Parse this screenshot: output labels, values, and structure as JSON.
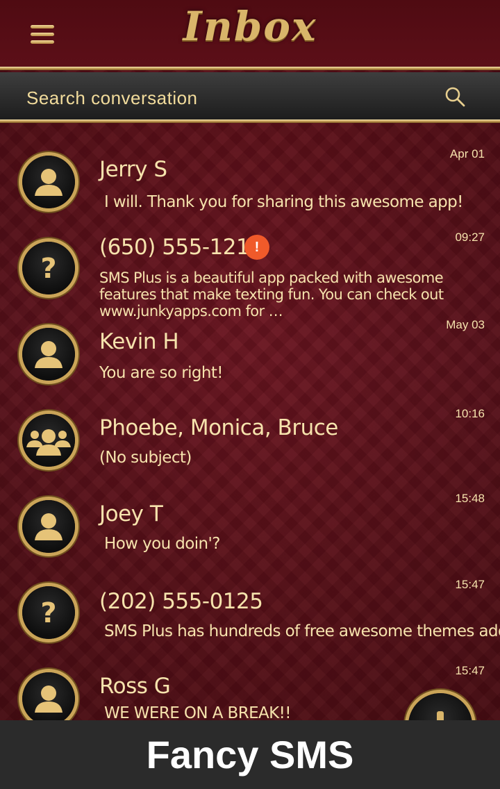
{
  "header": {
    "title": "Inbox"
  },
  "search": {
    "placeholder": "Search conversation"
  },
  "conversations": [
    {
      "name": "Jerry S",
      "message": "I will. Thank you for sharing this awesome app!",
      "time": "Apr 01",
      "avatar": "person-icon"
    },
    {
      "name": "(650) 555-1212",
      "message": "SMS Plus is a beautiful app packed with awesome features that make texting fun. You can check out www.junkyapps.com for …",
      "time": "09:27",
      "avatar": "question-icon",
      "badge": "!"
    },
    {
      "name": "Kevin H",
      "message": "You are so right!",
      "time": "May 03",
      "avatar": "person-icon"
    },
    {
      "name": "Phoebe, Monica, Bruce",
      "message": "(No subject)",
      "time": "10:16",
      "avatar": "group-icon"
    },
    {
      "name": "Joey T",
      "message": "How you doin'?",
      "time": "15:48",
      "avatar": "person-icon"
    },
    {
      "name": "(202) 555-0125",
      "message": "SMS Plus has hundreds of free awesome themes added daily",
      "time": "15:47",
      "avatar": "question-icon"
    },
    {
      "name": "Ross G",
      "message": "WE WERE ON A BREAK!!",
      "time": "15:47",
      "avatar": "person-icon"
    }
  ],
  "footer": {
    "label": "Fancy SMS"
  },
  "colors": {
    "accent_gold": "#d9b56a",
    "text": "#f6e3ad",
    "background": "#5e0e17",
    "badge": "#f05a2a"
  }
}
